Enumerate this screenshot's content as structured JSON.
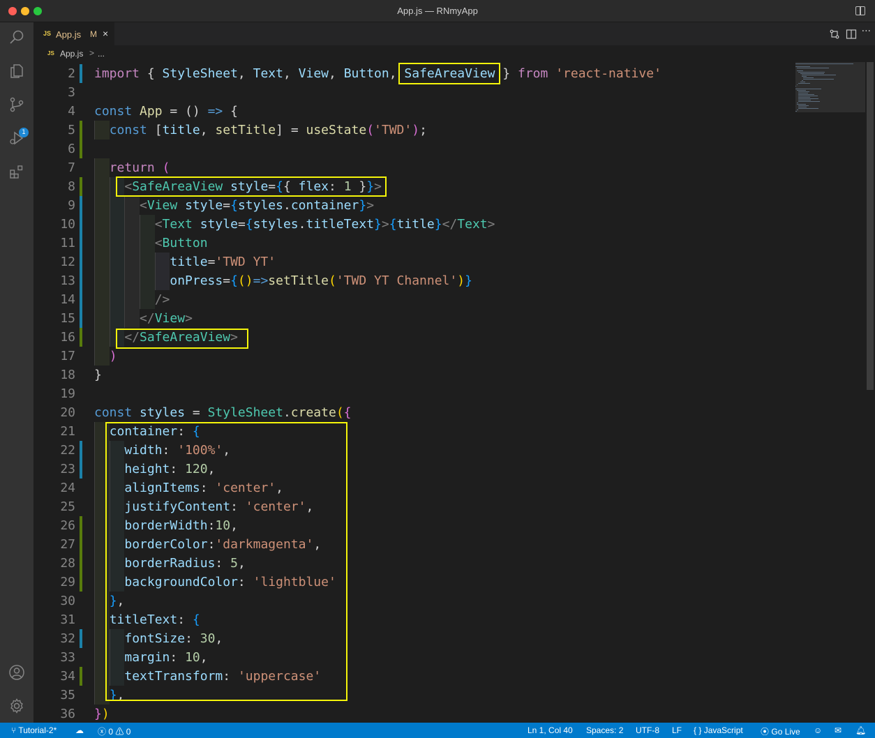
{
  "window": {
    "title": "App.js — RNmyApp"
  },
  "tab": {
    "icon": "JS",
    "name": "App.js",
    "modified": "M",
    "close": "×"
  },
  "breadcrumb": {
    "icon": "JS",
    "file": "App.js",
    "separator": ">",
    "more": "..."
  },
  "activity_bar": {
    "icons": [
      "search-icon",
      "explorer-icon",
      "source-control-icon",
      "run-debug-icon",
      "extensions-icon",
      "account-icon",
      "settings-gear-icon"
    ],
    "source_control_badge": "1"
  },
  "editor": {
    "lines": [
      {
        "n": "2",
        "tokens": [
          [
            "kwc",
            "import"
          ],
          [
            "punc",
            " { "
          ],
          [
            "var",
            "StyleSheet"
          ],
          [
            "punc",
            ", "
          ],
          [
            "var",
            "Text"
          ],
          [
            "punc",
            ", "
          ],
          [
            "var",
            "View"
          ],
          [
            "punc",
            ", "
          ],
          [
            "var",
            "Button"
          ],
          [
            "punc",
            ", "
          ],
          [
            "var",
            "SafeAreaView"
          ],
          [
            "punc",
            " } "
          ],
          [
            "kwc",
            "from"
          ],
          [
            "punc",
            " "
          ],
          [
            "str",
            "'react-native'"
          ]
        ]
      },
      {
        "n": "3",
        "tokens": []
      },
      {
        "n": "4",
        "tokens": [
          [
            "kw",
            "const"
          ],
          [
            "punc",
            " "
          ],
          [
            "fn",
            "App"
          ],
          [
            "punc",
            " = () "
          ],
          [
            "kw",
            "=>"
          ],
          [
            "punc",
            " {"
          ]
        ]
      },
      {
        "n": "5",
        "tokens": [
          [
            "punc",
            "  "
          ],
          [
            "kw",
            "const"
          ],
          [
            "punc",
            " ["
          ],
          [
            "var",
            "title"
          ],
          [
            "punc",
            ", "
          ],
          [
            "fn",
            "setTitle"
          ],
          [
            "punc",
            "] = "
          ],
          [
            "fn",
            "useState"
          ],
          [
            "br2",
            "("
          ],
          [
            "str",
            "'TWD'"
          ],
          [
            "br2",
            ")"
          ],
          [
            "punc",
            ";"
          ]
        ]
      },
      {
        "n": "6",
        "tokens": []
      },
      {
        "n": "7",
        "tokens": [
          [
            "punc",
            "  "
          ],
          [
            "kwc",
            "return"
          ],
          [
            "punc",
            " "
          ],
          [
            "br2",
            "("
          ]
        ]
      },
      {
        "n": "8",
        "tokens": [
          [
            "punc",
            "    "
          ],
          [
            "brk",
            "<"
          ],
          [
            "tag",
            "SafeAreaView"
          ],
          [
            "punc",
            " "
          ],
          [
            "var",
            "style"
          ],
          [
            "punc",
            "="
          ],
          [
            "br3",
            "{"
          ],
          [
            "punc",
            "{ "
          ],
          [
            "var",
            "flex"
          ],
          [
            "punc",
            ": "
          ],
          [
            "num",
            "1"
          ],
          [
            "punc",
            " }"
          ],
          [
            "br3",
            "}"
          ],
          [
            "brk",
            ">"
          ]
        ]
      },
      {
        "n": "9",
        "tokens": [
          [
            "punc",
            "      "
          ],
          [
            "brk",
            "<"
          ],
          [
            "tag",
            "View"
          ],
          [
            "punc",
            " "
          ],
          [
            "var",
            "style"
          ],
          [
            "punc",
            "="
          ],
          [
            "br3",
            "{"
          ],
          [
            "var",
            "styles"
          ],
          [
            "punc",
            "."
          ],
          [
            "var",
            "container"
          ],
          [
            "br3",
            "}"
          ],
          [
            "brk",
            ">"
          ]
        ]
      },
      {
        "n": "10",
        "tokens": [
          [
            "punc",
            "        "
          ],
          [
            "brk",
            "<"
          ],
          [
            "tag",
            "Text"
          ],
          [
            "punc",
            " "
          ],
          [
            "var",
            "style"
          ],
          [
            "punc",
            "="
          ],
          [
            "br3",
            "{"
          ],
          [
            "var",
            "styles"
          ],
          [
            "punc",
            "."
          ],
          [
            "var",
            "titleText"
          ],
          [
            "br3",
            "}"
          ],
          [
            "brk",
            ">"
          ],
          [
            "br3",
            "{"
          ],
          [
            "var",
            "title"
          ],
          [
            "br3",
            "}"
          ],
          [
            "brk",
            "</"
          ],
          [
            "tag",
            "Text"
          ],
          [
            "brk",
            ">"
          ]
        ]
      },
      {
        "n": "11",
        "tokens": [
          [
            "punc",
            "        "
          ],
          [
            "brk",
            "<"
          ],
          [
            "tag",
            "Button"
          ]
        ]
      },
      {
        "n": "12",
        "tokens": [
          [
            "punc",
            "          "
          ],
          [
            "var",
            "title"
          ],
          [
            "punc",
            "="
          ],
          [
            "str",
            "'TWD YT'"
          ]
        ]
      },
      {
        "n": "13",
        "tokens": [
          [
            "punc",
            "          "
          ],
          [
            "var",
            "onPress"
          ],
          [
            "punc",
            "="
          ],
          [
            "br3",
            "{"
          ],
          [
            "br1",
            "()"
          ],
          [
            "kw",
            "=>"
          ],
          [
            "fn",
            "setTitle"
          ],
          [
            "br1",
            "("
          ],
          [
            "str",
            "'TWD YT Channel'"
          ],
          [
            "br1",
            ")"
          ],
          [
            "br3",
            "}"
          ]
        ]
      },
      {
        "n": "14",
        "tokens": [
          [
            "punc",
            "        "
          ],
          [
            "brk",
            "/>"
          ]
        ]
      },
      {
        "n": "15",
        "tokens": [
          [
            "punc",
            "      "
          ],
          [
            "brk",
            "</"
          ],
          [
            "tag",
            "View"
          ],
          [
            "brk",
            ">"
          ]
        ]
      },
      {
        "n": "16",
        "tokens": [
          [
            "punc",
            "    "
          ],
          [
            "brk",
            "</"
          ],
          [
            "tag",
            "SafeAreaView"
          ],
          [
            "brk",
            ">"
          ]
        ]
      },
      {
        "n": "17",
        "tokens": [
          [
            "punc",
            "  "
          ],
          [
            "br2",
            ")"
          ]
        ]
      },
      {
        "n": "18",
        "tokens": [
          [
            "punc",
            "}"
          ]
        ]
      },
      {
        "n": "19",
        "tokens": []
      },
      {
        "n": "20",
        "tokens": [
          [
            "kw",
            "const"
          ],
          [
            "punc",
            " "
          ],
          [
            "var",
            "styles"
          ],
          [
            "punc",
            " = "
          ],
          [
            "cls",
            "StyleSheet"
          ],
          [
            "punc",
            "."
          ],
          [
            "fn",
            "create"
          ],
          [
            "br1",
            "("
          ],
          [
            "br2",
            "{"
          ]
        ]
      },
      {
        "n": "21",
        "tokens": [
          [
            "punc",
            "  "
          ],
          [
            "var",
            "container"
          ],
          [
            "punc",
            ": "
          ],
          [
            "br3",
            "{"
          ]
        ]
      },
      {
        "n": "22",
        "tokens": [
          [
            "punc",
            "    "
          ],
          [
            "var",
            "width"
          ],
          [
            "punc",
            ": "
          ],
          [
            "str",
            "'100%'"
          ],
          [
            "punc",
            ","
          ]
        ]
      },
      {
        "n": "23",
        "tokens": [
          [
            "punc",
            "    "
          ],
          [
            "var",
            "height"
          ],
          [
            "punc",
            ": "
          ],
          [
            "num",
            "120"
          ],
          [
            "punc",
            ","
          ]
        ]
      },
      {
        "n": "24",
        "tokens": [
          [
            "punc",
            "    "
          ],
          [
            "var",
            "alignItems"
          ],
          [
            "punc",
            ": "
          ],
          [
            "str",
            "'center'"
          ],
          [
            "punc",
            ","
          ]
        ]
      },
      {
        "n": "25",
        "tokens": [
          [
            "punc",
            "    "
          ],
          [
            "var",
            "justifyContent"
          ],
          [
            "punc",
            ": "
          ],
          [
            "str",
            "'center'"
          ],
          [
            "punc",
            ","
          ]
        ]
      },
      {
        "n": "26",
        "tokens": [
          [
            "punc",
            "    "
          ],
          [
            "var",
            "borderWidth"
          ],
          [
            "punc",
            ":"
          ],
          [
            "num",
            "10"
          ],
          [
            "punc",
            ","
          ]
        ]
      },
      {
        "n": "27",
        "tokens": [
          [
            "punc",
            "    "
          ],
          [
            "var",
            "borderColor"
          ],
          [
            "punc",
            ":"
          ],
          [
            "str",
            "'darkmagenta'"
          ],
          [
            "punc",
            ","
          ]
        ]
      },
      {
        "n": "28",
        "tokens": [
          [
            "punc",
            "    "
          ],
          [
            "var",
            "borderRadius"
          ],
          [
            "punc",
            ": "
          ],
          [
            "num",
            "5"
          ],
          [
            "punc",
            ","
          ]
        ]
      },
      {
        "n": "29",
        "tokens": [
          [
            "punc",
            "    "
          ],
          [
            "var",
            "backgroundColor"
          ],
          [
            "punc",
            ": "
          ],
          [
            "str",
            "'lightblue'"
          ]
        ]
      },
      {
        "n": "30",
        "tokens": [
          [
            "punc",
            "  "
          ],
          [
            "br3",
            "}"
          ],
          [
            "punc",
            ","
          ]
        ]
      },
      {
        "n": "31",
        "tokens": [
          [
            "punc",
            "  "
          ],
          [
            "var",
            "titleText"
          ],
          [
            "punc",
            ": "
          ],
          [
            "br3",
            "{"
          ]
        ]
      },
      {
        "n": "32",
        "tokens": [
          [
            "punc",
            "    "
          ],
          [
            "var",
            "fontSize"
          ],
          [
            "punc",
            ": "
          ],
          [
            "num",
            "30"
          ],
          [
            "punc",
            ","
          ]
        ]
      },
      {
        "n": "33",
        "tokens": [
          [
            "punc",
            "    "
          ],
          [
            "var",
            "margin"
          ],
          [
            "punc",
            ": "
          ],
          [
            "num",
            "10"
          ],
          [
            "punc",
            ","
          ]
        ]
      },
      {
        "n": "34",
        "tokens": [
          [
            "punc",
            "    "
          ],
          [
            "var",
            "textTransform"
          ],
          [
            "punc",
            ": "
          ],
          [
            "str",
            "'uppercase'"
          ]
        ]
      },
      {
        "n": "35",
        "tokens": [
          [
            "punc",
            "  "
          ],
          [
            "br3",
            "}"
          ],
          [
            "punc",
            ","
          ]
        ]
      },
      {
        "n": "36",
        "tokens": [
          [
            "br2",
            "}"
          ],
          [
            "br1",
            ")"
          ]
        ]
      }
    ]
  },
  "statusbar": {
    "branch": "Tutorial-2*",
    "errors": "0",
    "warnings": "0",
    "position": "Ln 1, Col 40",
    "spaces": "Spaces: 2",
    "encoding": "UTF-8",
    "eol": "LF",
    "language_icon": "{ }",
    "language": "JavaScript",
    "go_live": "Go Live"
  },
  "colors": {
    "highlight_box": "#f5f50a",
    "status_bar": "#007acc",
    "activity_bar": "#333333",
    "editor_bg": "#1e1e1e"
  }
}
